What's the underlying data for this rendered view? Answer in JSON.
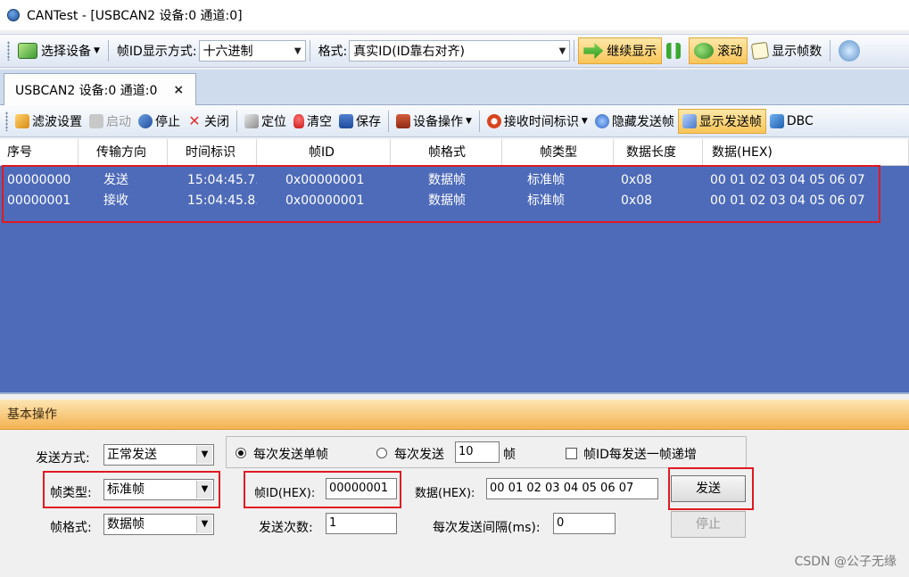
{
  "window": {
    "title": "CANTest  - [USBCAN2 设备:0 通道:0]"
  },
  "toolbar1": {
    "select_device": "选择设备",
    "id_display_label": "帧ID显示方式:",
    "id_display_value": "十六进制",
    "format_label": "格式:",
    "format_value": "真实ID(ID靠右对齐)",
    "continue_display": "继续显示",
    "scroll": "滚动",
    "show_frame_count": "显示帧数"
  },
  "tab": {
    "label": "USBCAN2 设备:0 通道:0",
    "close": "×"
  },
  "toolbar2": {
    "filter": "滤波设置",
    "start": "启动",
    "stop": "停止",
    "close": "关闭",
    "locate": "定位",
    "clear": "清空",
    "save": "保存",
    "device_ops": "设备操作",
    "rx_timestamp": "接收时间标识",
    "hide_sent": "隐藏发送帧",
    "show_sent": "显示发送帧",
    "dbc": "DBC"
  },
  "grid": {
    "columns": [
      "序号",
      "传输方向",
      "时间标识",
      "帧ID",
      "帧格式",
      "帧类型",
      "数据长度",
      "数据(HEX)"
    ],
    "rows": [
      [
        "00000000",
        "发送",
        "15:04:45.7...",
        "0x00000001",
        "数据帧",
        "标准帧",
        "0x08",
        "00 01 02 03 04 05 06 07"
      ],
      [
        "00000001",
        "接收",
        "15:04:45.8...",
        "0x00000001",
        "数据帧",
        "标准帧",
        "0x08",
        "00 01 02 03 04 05 06 07"
      ]
    ]
  },
  "basic": {
    "header": "基本操作",
    "send_mode_label": "发送方式:",
    "send_mode_value": "正常发送",
    "frame_type_label": "帧类型:",
    "frame_type_value": "标准帧",
    "frame_format_label": "帧格式:",
    "frame_format_value": "数据帧",
    "radio_single": "每次发送单帧",
    "radio_multi": "每次发送",
    "multi_count": "10",
    "multi_unit": "帧",
    "id_increment": "帧ID每发送一帧递增",
    "frame_id_label": "帧ID(HEX):",
    "frame_id_value": "00000001",
    "data_label": "数据(HEX):",
    "data_value": "00 01 02 03 04 05 06 07",
    "send_count_label": "发送次数:",
    "send_count_value": "1",
    "interval_label": "每次发送间隔(ms):",
    "interval_value": "0",
    "send_button": "发送",
    "stop_button": "停止"
  },
  "watermark": "CSDN @公子无缘",
  "colors": {
    "grid_bg": "#4e6bb9",
    "highlight": "#e01a22",
    "header_orange": "#f4b252"
  }
}
